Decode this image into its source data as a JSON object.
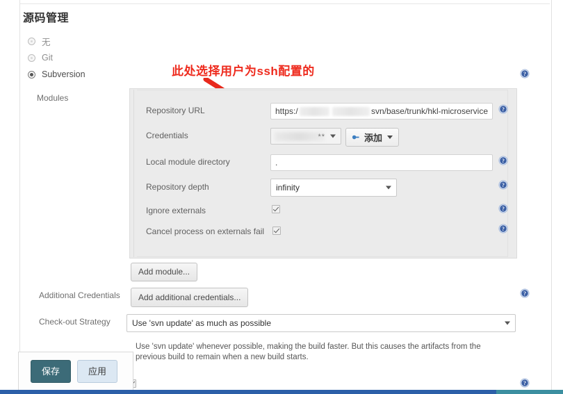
{
  "section": {
    "title": "源码管理"
  },
  "scm_options": [
    {
      "label": "无",
      "selected": false
    },
    {
      "label": "Git",
      "selected": false
    },
    {
      "label": "Subversion",
      "selected": true
    }
  ],
  "labels": {
    "modules": "Modules",
    "additional_credentials": "Additional Credentials",
    "checkout_strategy": "Check-out Strategy"
  },
  "module_form": {
    "repository_url": {
      "label": "Repository URL",
      "value_prefix": "https:/",
      "value_suffix": "svn/base/trunk/hkl-microservice",
      "redacted": true
    },
    "credentials": {
      "label": "Credentials",
      "value_masked": "**",
      "redacted": true,
      "add_button": "添加"
    },
    "local_module_directory": {
      "label": "Local module directory",
      "value": "."
    },
    "repository_depth": {
      "label": "Repository depth",
      "value": "infinity"
    },
    "ignore_externals": {
      "label": "Ignore externals",
      "checked": true
    },
    "cancel_process_on_externals_fail": {
      "label": "Cancel process on externals fail",
      "checked": true
    },
    "add_module_button": "Add module..."
  },
  "additional_credentials": {
    "button": "Add additional credentials..."
  },
  "checkout_strategy": {
    "value": "Use 'svn update' as much as possible",
    "description": "Use 'svn update' whenever possible, making the build faster. But this causes the artifacts from the previous build to remain when a new build starts."
  },
  "bottom_checkbox": {
    "checked": true
  },
  "actions": {
    "save": "保存",
    "apply": "应用"
  },
  "annotation": {
    "text": "此处选择用户为ssh配置的",
    "color": "#ee2b1e"
  },
  "colors": {
    "primary_button": "#3c6b78",
    "secondary_button": "#dce8f3",
    "panel_bg": "#ebebeb",
    "help_icon": "#3b5fa4",
    "bottom_bar": "#2c5fa8"
  },
  "icons": {
    "help": "question-mark-circle",
    "add_credentials": "blue-arrow"
  }
}
